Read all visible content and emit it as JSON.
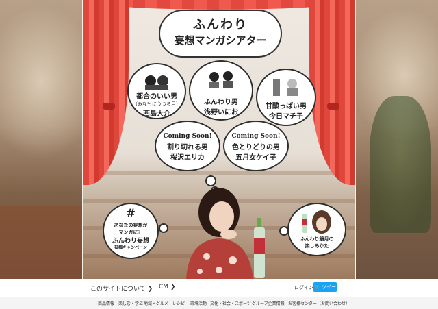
{
  "title": {
    "line1": "ふんわり",
    "line2": "妄想マンガシアター"
  },
  "bubbles": [
    {
      "name": "nishijima",
      "line1": "都合のいい男",
      "sub": "（みなもにうつる月）",
      "line2": "西島大介"
    },
    {
      "name": "asano",
      "line1": "ふんわり男",
      "line2": "浅野いにお"
    },
    {
      "name": "imaichi",
      "line1": "甘酸っぱい男",
      "line2": "今日マチ子"
    },
    {
      "name": "sakurazawa",
      "soon": "Coming Soon!",
      "line1": "割り切れる男",
      "line2": "桜沢エリカ"
    },
    {
      "name": "satsuki",
      "soon": "Coming Soon!",
      "line1": "色とりどりの男",
      "line2": "五月女ケイ子"
    }
  ],
  "campaign": {
    "hash": "#",
    "line1": "あなたの妄想が",
    "line2": "マンガに？",
    "line3": "ふんわり妄想",
    "line4": "投稿キャンペーン"
  },
  "enjoy": {
    "line1": "ふんわり鏡月の",
    "line2": "楽しみかた"
  },
  "footer": {
    "about": "このサイトについて",
    "cm": "CM",
    "login": "ログイン",
    "tweet": "ツイート",
    "links": [
      "商品情報",
      "楽しむ・学ぶ",
      "地域・グルメ",
      "レシピ",
      "環境活動",
      "文化・社会・スポーツ",
      "グループ企業情報",
      "お客様センター（お問い合わせ）"
    ]
  },
  "colors": {
    "curtain": "#e0473c",
    "twitter": "#1da1f2"
  }
}
